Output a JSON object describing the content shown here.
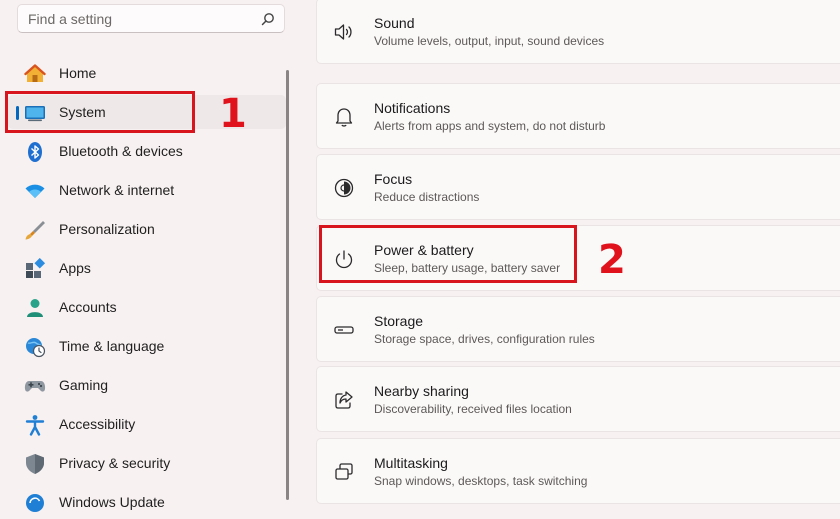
{
  "search": {
    "placeholder": "Find a setting",
    "icon": "search-icon"
  },
  "sidebar": {
    "items": [
      {
        "label": "Home",
        "icon": "home-icon"
      },
      {
        "label": "System",
        "icon": "monitor-icon",
        "selected": true
      },
      {
        "label": "Bluetooth & devices",
        "icon": "bluetooth-icon"
      },
      {
        "label": "Network & internet",
        "icon": "wifi-icon"
      },
      {
        "label": "Personalization",
        "icon": "brush-icon"
      },
      {
        "label": "Apps",
        "icon": "apps-icon"
      },
      {
        "label": "Accounts",
        "icon": "person-icon"
      },
      {
        "label": "Time & language",
        "icon": "globe-clock-icon"
      },
      {
        "label": "Gaming",
        "icon": "gamepad-icon"
      },
      {
        "label": "Accessibility",
        "icon": "accessibility-icon"
      },
      {
        "label": "Privacy & security",
        "icon": "shield-icon"
      },
      {
        "label": "Windows Update",
        "icon": "update-icon"
      }
    ]
  },
  "settings": [
    {
      "title": "Sound",
      "subtitle": "Volume levels, output, input, sound devices",
      "icon": "speaker-icon"
    },
    {
      "title": "Notifications",
      "subtitle": "Alerts from apps and system, do not disturb",
      "icon": "bell-icon"
    },
    {
      "title": "Focus",
      "subtitle": "Reduce distractions",
      "icon": "focus-icon"
    },
    {
      "title": "Power & battery",
      "subtitle": "Sleep, battery usage, battery saver",
      "icon": "power-icon"
    },
    {
      "title": "Storage",
      "subtitle": "Storage space, drives, configuration rules",
      "icon": "storage-icon"
    },
    {
      "title": "Nearby sharing",
      "subtitle": "Discoverability, received files location",
      "icon": "share-icon"
    },
    {
      "title": "Multitasking",
      "subtitle": "Snap windows, desktops, task switching",
      "icon": "multitask-icon"
    }
  ],
  "annotations": {
    "step1": "1",
    "step2": "2"
  },
  "colors": {
    "accent": "#0067c0",
    "highlight": "#d8141c",
    "background": "#f8f1f1"
  }
}
